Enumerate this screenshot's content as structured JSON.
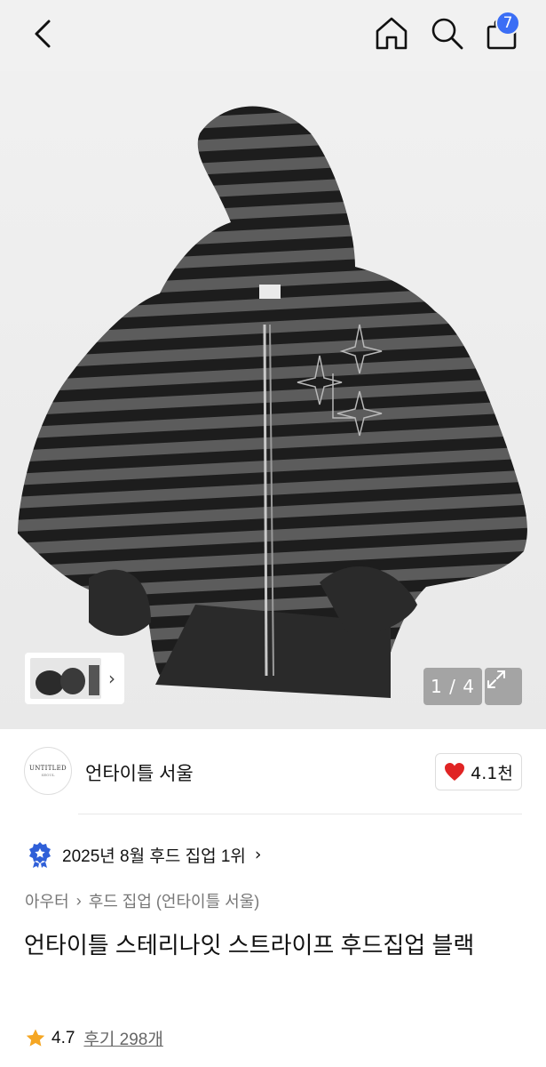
{
  "header": {
    "cart_count": "7"
  },
  "gallery": {
    "counter": "1 / 4"
  },
  "shop": {
    "logo_text": "UNTITLED",
    "logo_sub": "SEOUL",
    "name": "언타이틀 서울",
    "likes": "4.1천"
  },
  "ranking": {
    "text": "2025년 8월 후드 집업 1위"
  },
  "breadcrumb": {
    "category": "아우터",
    "subcategory": "후드 집업 (언타이틀 서울)"
  },
  "product": {
    "title": "언타이틀 스테리나잇 스트라이프 후드집업 블랙"
  },
  "rating": {
    "score": "4.7",
    "reviews": "후기 298개"
  },
  "colors": {
    "accent": "#3b6ef5",
    "heart": "#e02424",
    "star": "#f5a623",
    "stripe_dark": "#1d1d1d",
    "stripe_light": "#5a5a5a"
  }
}
